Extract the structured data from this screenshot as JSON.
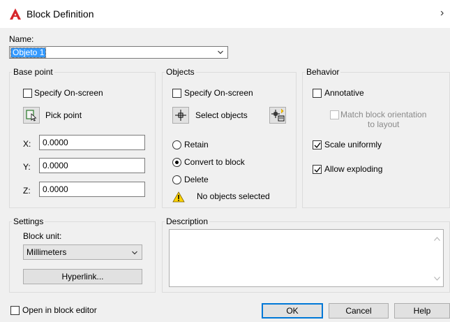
{
  "window": {
    "title": "Block Definition",
    "close": "›"
  },
  "name": {
    "label": "Name:",
    "value": "Objeto 1"
  },
  "base_point": {
    "title": "Base point",
    "specify_onscreen": {
      "label": "Specify On-screen",
      "checked": false
    },
    "pick_point_label": "Pick point",
    "x": {
      "label": "X:",
      "value": "0.0000"
    },
    "y": {
      "label": "Y:",
      "value": "0.0000"
    },
    "z": {
      "label": "Z:",
      "value": "0.0000"
    }
  },
  "objects": {
    "title": "Objects",
    "specify_onscreen": {
      "label": "Specify On-screen",
      "checked": false
    },
    "select_objects_label": "Select objects",
    "retain_label": "Retain",
    "convert_label": "Convert to block",
    "delete_label": "Delete",
    "selected": "convert",
    "status": "No objects selected"
  },
  "behavior": {
    "title": "Behavior",
    "annotative": {
      "label": "Annotative",
      "checked": false
    },
    "match_orientation": {
      "label": "Match block orientation\nto layout",
      "checked": false,
      "enabled": false
    },
    "scale_uniformly": {
      "label": "Scale uniformly",
      "checked": true
    },
    "allow_exploding": {
      "label": "Allow exploding",
      "checked": true
    }
  },
  "settings": {
    "title": "Settings",
    "block_unit_label": "Block unit:",
    "block_unit_value": "Millimeters",
    "hyperlink_label": "Hyperlink..."
  },
  "description": {
    "title": "Description",
    "value": ""
  },
  "footer": {
    "open_in_editor": {
      "label": "Open in block editor",
      "checked": false
    },
    "ok_label": "OK",
    "cancel_label": "Cancel",
    "help_label": "Help"
  },
  "colors": {
    "logo_red": "#d7262b",
    "selection_blue": "#3399ff",
    "default_button_border": "#0078d7",
    "warning_yellow": "#ffd200"
  }
}
